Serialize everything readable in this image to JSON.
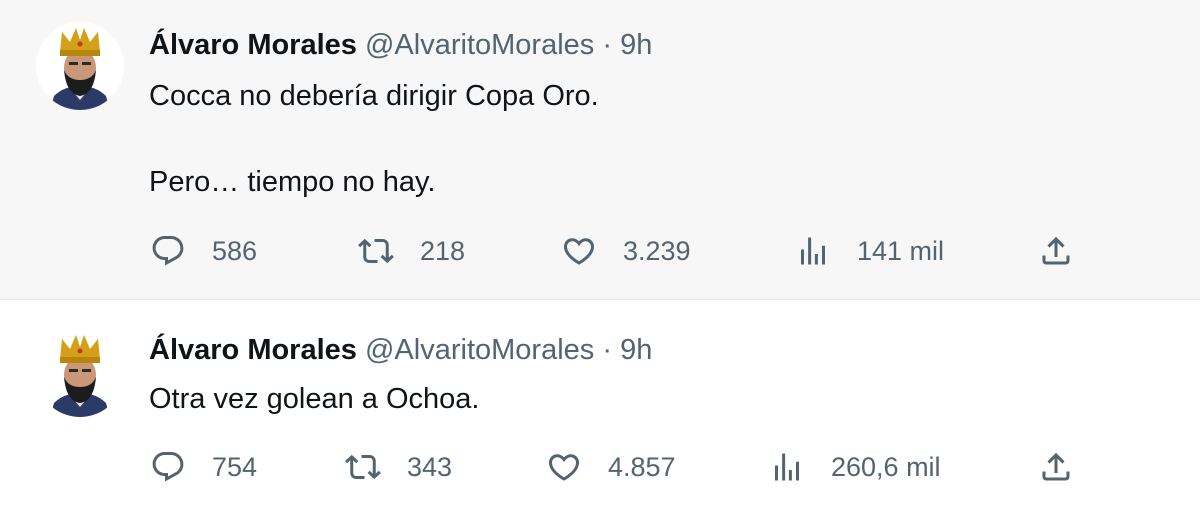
{
  "tweets": [
    {
      "author": "Álvaro Morales",
      "handle": "@AlvaritoMorales",
      "separator": "·",
      "time": "9h",
      "lines": [
        "Cocca no debería dirigir Copa Oro.",
        "Pero… tiempo no hay."
      ],
      "replies": "586",
      "retweets": "218",
      "likes": "3.239",
      "views": "141 mil"
    },
    {
      "author": "Álvaro Morales",
      "handle": "@AlvaritoMorales",
      "separator": "·",
      "time": "9h",
      "lines": [
        "Otra vez golean a Ochoa."
      ],
      "replies": "754",
      "retweets": "343",
      "likes": "4.857",
      "views": "260,6 mil"
    }
  ],
  "icons": {
    "reply": "reply-icon",
    "retweet": "retweet-icon",
    "like": "heart-icon",
    "views": "views-icon",
    "share": "share-icon"
  },
  "colors": {
    "text": "#0f1419",
    "secondary": "#536471",
    "highlight_bg": "#f7f7f7"
  }
}
